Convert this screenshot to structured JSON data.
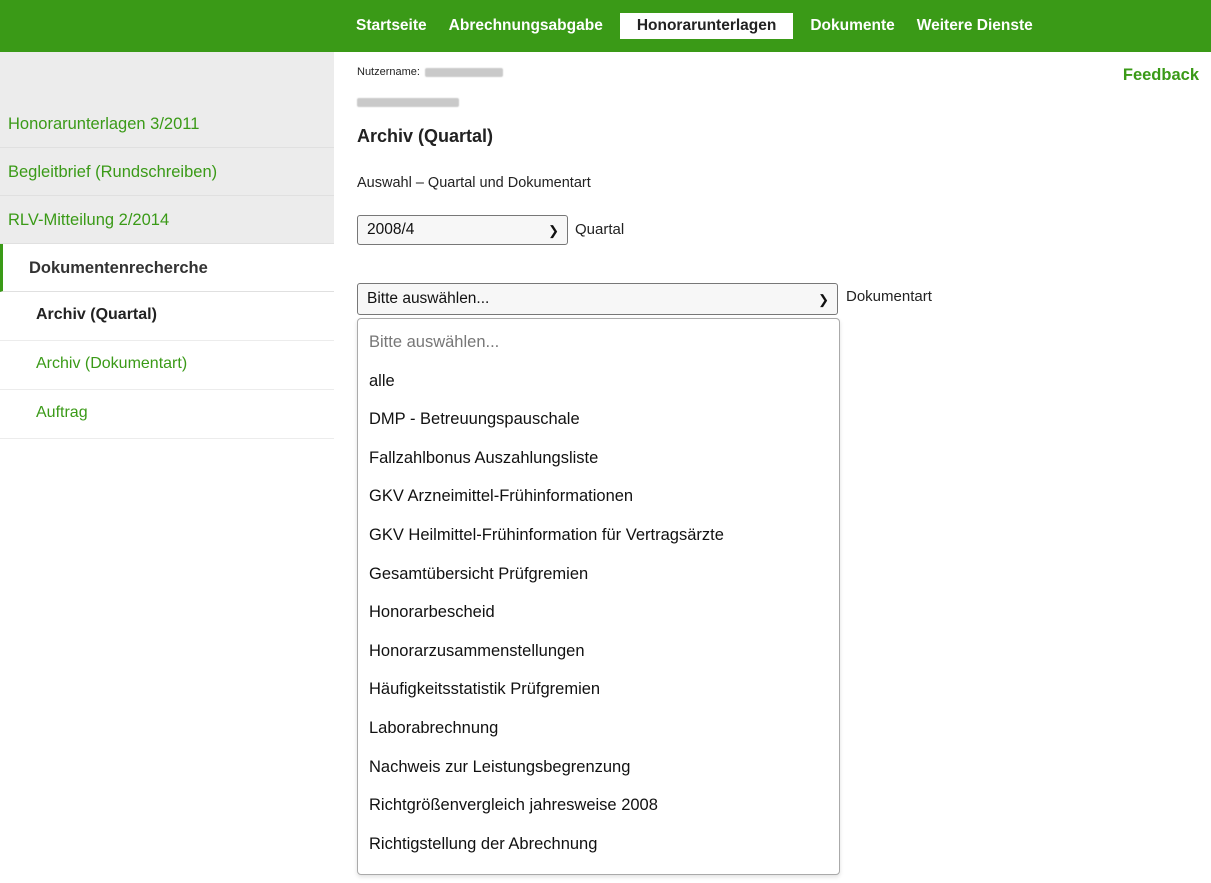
{
  "nav": {
    "tabs": [
      {
        "label": "Startseite"
      },
      {
        "label": "Abrechnungsabgabe"
      },
      {
        "label": "Honorarunterlagen"
      },
      {
        "label": "Dokumente"
      },
      {
        "label": "Weitere Dienste"
      }
    ],
    "active_tab": "Honorarunterlagen"
  },
  "colors": {
    "accent": "#3a9a17",
    "sidebar_bg": "#ececec"
  },
  "user": {
    "label": "Nutzername:",
    "feedback": "Feedback"
  },
  "sidebar": {
    "items": [
      {
        "label": "Honorarunterlagen 3/2011"
      },
      {
        "label": "Begleitbrief (Rundschreiben)"
      },
      {
        "label": "RLV-Mitteilung 2/2014"
      }
    ],
    "section": {
      "label": "Dokumentenrecherche"
    },
    "subitems": [
      {
        "label": "Archiv (Quartal)"
      },
      {
        "label": "Archiv (Dokumentart)"
      },
      {
        "label": "Auftrag"
      }
    ]
  },
  "main": {
    "title": "Archiv (Quartal)",
    "subheading": "Auswahl – Quartal und Dokumentart",
    "quartal": {
      "value": "2008/4",
      "label": "Quartal"
    },
    "dokumentart": {
      "value": "Bitte auswählen...",
      "label": "Dokumentart",
      "options": [
        "Bitte auswählen...",
        "alle",
        "DMP - Betreuungspauschale",
        "Fallzahlbonus Auszahlungsliste",
        "GKV Arzneimittel-Frühinformationen",
        "GKV Heilmittel-Frühinformation für Vertragsärzte",
        "Gesamtübersicht Prüfgremien",
        "Honorarbescheid",
        "Honorarzusammenstellungen",
        "Häufigkeitsstatistik Prüfgremien",
        "Laborabrechnung",
        "Nachweis zur Leistungsbegrenzung",
        "Richtgrößenvergleich jahresweise 2008",
        "Richtigstellung der Abrechnung"
      ]
    }
  }
}
